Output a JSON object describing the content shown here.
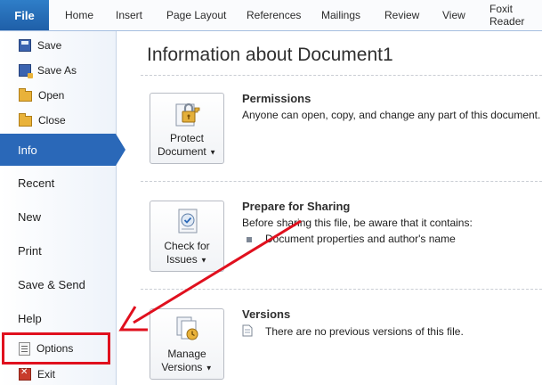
{
  "ribbon": {
    "file_tab": "File",
    "tabs": [
      "Home",
      "Insert",
      "Page Layout",
      "References",
      "Mailings",
      "Review",
      "View",
      "Foxit Reader"
    ]
  },
  "backstage": {
    "commands_top": [
      {
        "label": "Save",
        "icon": "save-icon"
      },
      {
        "label": "Save As",
        "icon": "save-as-icon"
      },
      {
        "label": "Open",
        "icon": "open-folder-icon"
      },
      {
        "label": "Close",
        "icon": "close-folder-icon"
      }
    ],
    "tabs": [
      {
        "label": "Info",
        "active": true
      },
      {
        "label": "Recent"
      },
      {
        "label": "New"
      },
      {
        "label": "Print"
      },
      {
        "label": "Save & Send"
      },
      {
        "label": "Help"
      }
    ],
    "commands_bottom": [
      {
        "label": "Options",
        "icon": "options-icon"
      },
      {
        "label": "Exit",
        "icon": "exit-icon"
      }
    ]
  },
  "info": {
    "title": "Information about Document1",
    "permissions": {
      "button_line1": "Protect",
      "button_line2": "Document",
      "title": "Permissions",
      "text": "Anyone can open, copy, and change any part of this document."
    },
    "prepare": {
      "button_line1": "Check for",
      "button_line2": "Issues",
      "title": "Prepare for Sharing",
      "text": "Before sharing this file, be aware that it contains:",
      "bullet": "Document properties and author's name"
    },
    "versions": {
      "button_line1": "Manage",
      "button_line2": "Versions",
      "title": "Versions",
      "text": "There are no previous versions of this file."
    }
  },
  "colors": {
    "highlight": "#e0101e",
    "arrow": "#e0101e",
    "accent": "#2a68b8"
  }
}
